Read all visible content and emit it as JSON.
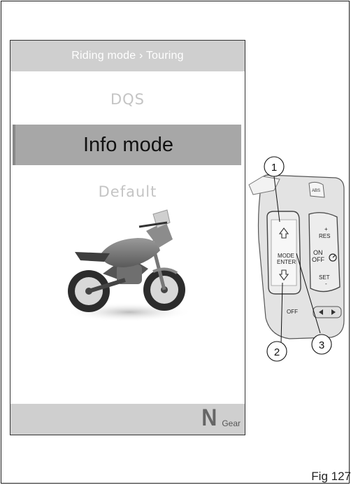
{
  "display": {
    "header": "Riding mode › Touring",
    "items": [
      "DQS",
      "Info mode",
      "Default"
    ],
    "selected_index": 1,
    "gear_value": "N",
    "gear_label": "Gear"
  },
  "switchgear": {
    "callouts": [
      "1",
      "2",
      "3"
    ],
    "labels": {
      "mode": "MODE",
      "enter": "ENTER",
      "res": "RES",
      "set": "SET",
      "on": "ON",
      "off": "OFF",
      "off_lower": "OFF",
      "abs": "ABS",
      "plus": "+",
      "minus": "-"
    }
  },
  "figure_label": "Fig 127"
}
